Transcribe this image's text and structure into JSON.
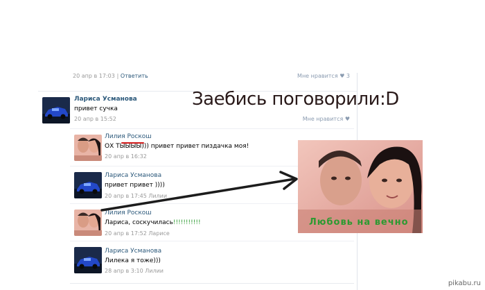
{
  "heading": "Заебись поговорили:D",
  "caption": "Любовь на вечно",
  "watermark": "pikabu.ru",
  "top": {
    "date": "20 апр в 17:03",
    "reply": "Ответить",
    "like": "Мне нравится",
    "count": "3"
  },
  "post": {
    "author": "Лариса Усманова",
    "text": "привет сучка",
    "time": "20 апр в 15:52",
    "like": "Мне нравится"
  },
  "replies": [
    {
      "author": "Лилия Роскош",
      "text": "ОХ ТЫЫЫЫ))) привет привет пиздачка моя!",
      "time": "20 апр в 16:32",
      "avatar": "couple"
    },
    {
      "author": "Лариса Усманова",
      "text": "привет привет ))))",
      "time": "20 апр в 17:45 Лилии",
      "avatar": "car"
    },
    {
      "author": "Лилия Роскош",
      "text": "Лариса, соскучилась",
      "text_highlight": "!!!!!!!!!!!",
      "time": "20 апр в 17:52 Ларисе",
      "avatar": "couple"
    },
    {
      "author": "Лариса Усманова",
      "text": "Лилека я тоже)))",
      "time": "28 апр в 3:10 Лилии",
      "avatar": "car"
    }
  ],
  "colors": {
    "link": "#2b587a",
    "caption": "#2d9a31",
    "underline": "#d21a1a"
  }
}
